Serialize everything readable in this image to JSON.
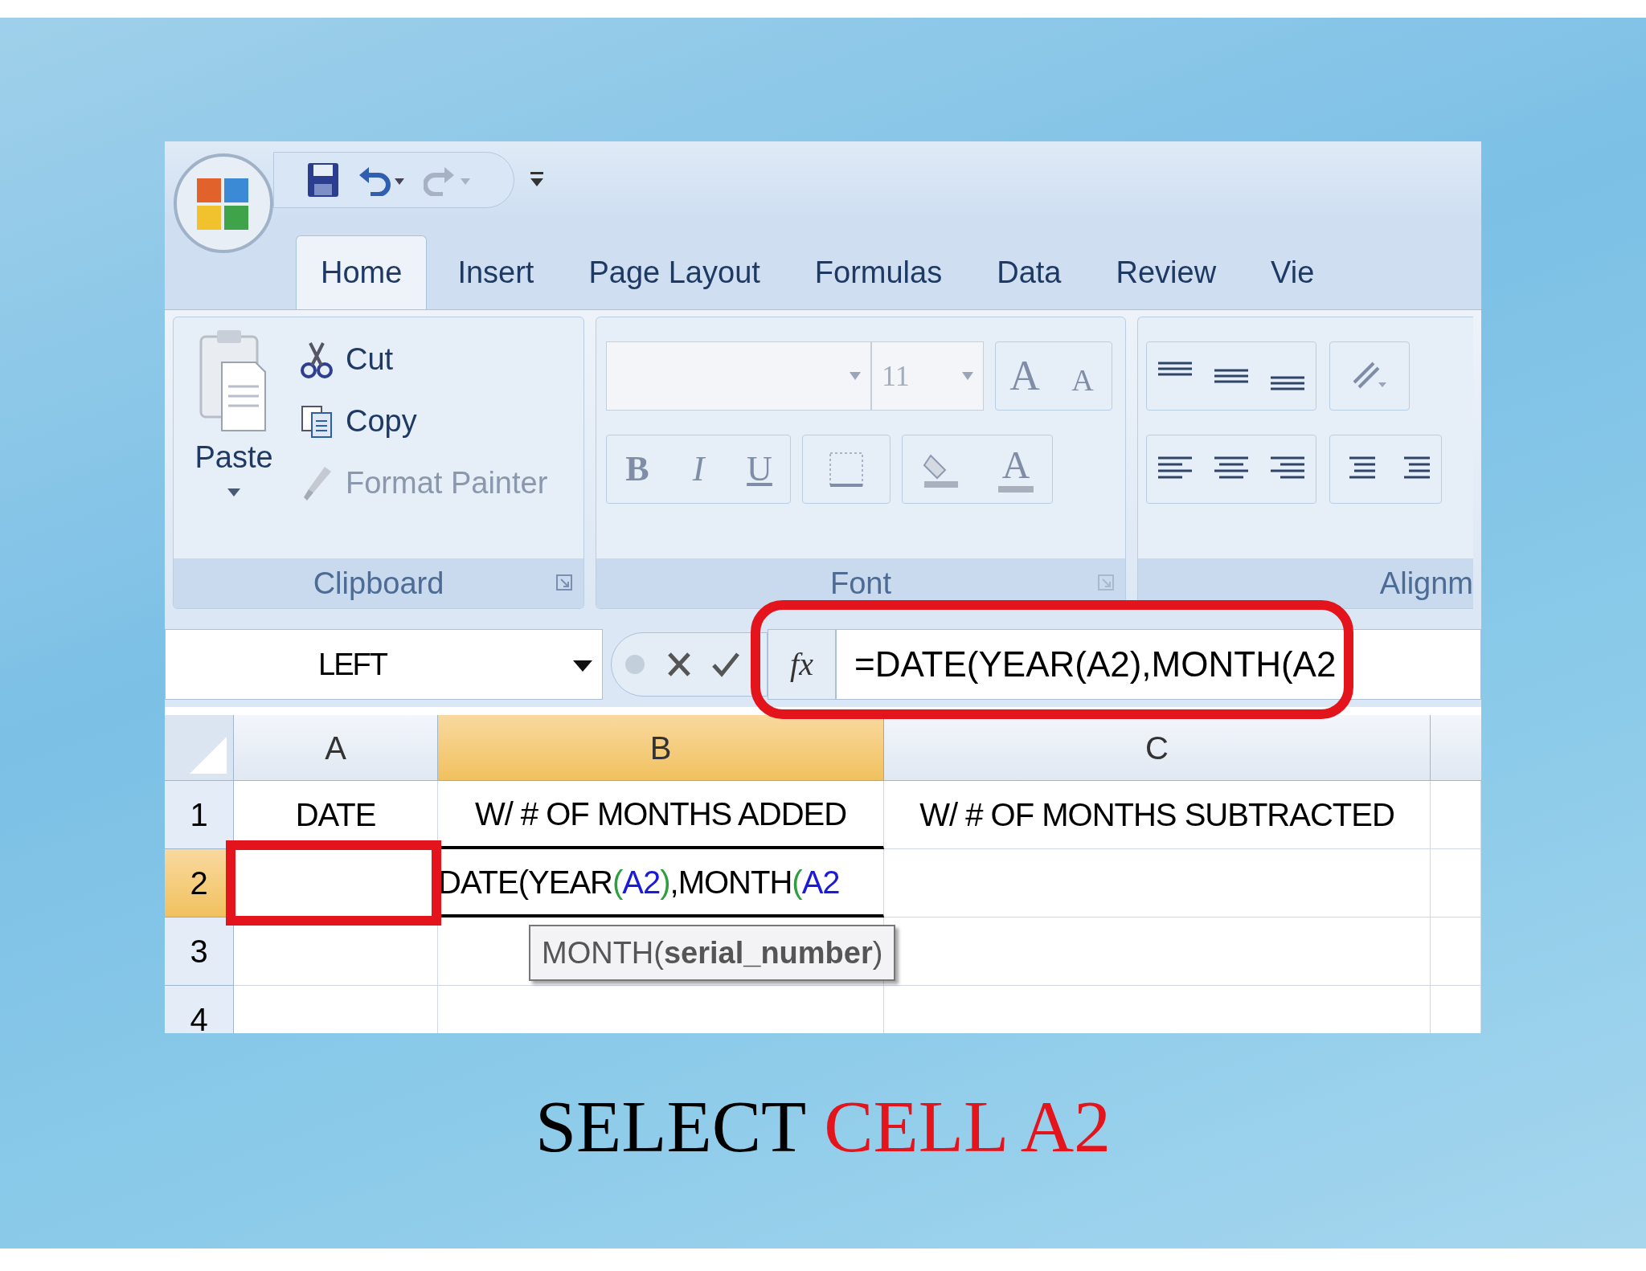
{
  "tabs": [
    {
      "label": "Home",
      "selected": true
    },
    {
      "label": "Insert",
      "selected": false
    },
    {
      "label": "Page Layout",
      "selected": false
    },
    {
      "label": "Formulas",
      "selected": false
    },
    {
      "label": "Data",
      "selected": false
    },
    {
      "label": "Review",
      "selected": false
    },
    {
      "label": "Vie",
      "selected": false
    }
  ],
  "clipboard": {
    "paste": "Paste",
    "items": [
      {
        "label": "Cut",
        "disabled": false
      },
      {
        "label": "Copy",
        "disabled": false
      },
      {
        "label": "Format Painter",
        "disabled": true
      }
    ],
    "group_label": "Clipboard"
  },
  "font": {
    "size": "11",
    "format_buttons": [
      "B",
      "I",
      "U"
    ],
    "grow": "A",
    "shrink": "A",
    "font_color": "A",
    "group_label": "Font"
  },
  "alignment": {
    "group_label": "Alignm"
  },
  "formula_bar": {
    "name_box": "LEFT",
    "fx": "fx",
    "formula": "=DATE(YEAR(A2),MONTH(A2"
  },
  "columns": [
    {
      "label": "A",
      "selected": false
    },
    {
      "label": "B",
      "selected": true
    },
    {
      "label": "C",
      "selected": false
    }
  ],
  "rows": [
    {
      "label": "1",
      "selected": false,
      "cells": [
        "DATE",
        "W/ # OF MONTHS ADDED",
        "W/ # OF MONTHS SUBTRACTED"
      ]
    },
    {
      "label": "2",
      "selected": true,
      "formula_parts": [
        {
          "text": "DATE(YEAR",
          "color": "#000000"
        },
        {
          "text": "(",
          "color": "#2e9e3e"
        },
        {
          "text": "A2",
          "color": "#1a1ad8"
        },
        {
          "text": ")",
          "color": "#2e9e3e"
        },
        {
          "text": ",MONTH",
          "color": "#000000"
        },
        {
          "text": "(",
          "color": "#2e9e3e"
        },
        {
          "text": "A2",
          "color": "#1a1ad8"
        }
      ]
    },
    {
      "label": "3",
      "selected": false
    },
    {
      "label": "4",
      "selected": false
    }
  ],
  "tooltip": "MONTH(**serial_number**)",
  "caption": [
    {
      "text": "SELECT",
      "color": "#000000"
    },
    {
      "text": "CELL A2",
      "color": "#e3141b"
    }
  ]
}
